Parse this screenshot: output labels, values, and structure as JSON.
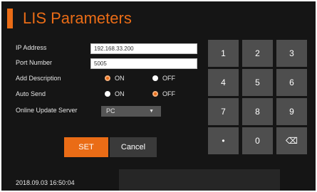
{
  "title": "LIS Parameters",
  "form": {
    "ip_label": "IP Address",
    "ip_value": "192.168.33.200",
    "port_label": "Port Number",
    "port_value": "5005",
    "add_desc_label": "Add Description",
    "add_desc_on": "ON",
    "add_desc_off": "OFF",
    "add_desc_selected": "ON",
    "auto_send_label": "Auto Send",
    "auto_send_on": "ON",
    "auto_send_off": "OFF",
    "auto_send_selected": "OFF",
    "server_label": "Online Update Server",
    "server_value": "PC"
  },
  "buttons": {
    "set": "SET",
    "cancel": "Cancel"
  },
  "keypad": {
    "k1": "1",
    "k2": "2",
    "k3": "3",
    "k4": "4",
    "k5": "5",
    "k6": "6",
    "k7": "7",
    "k8": "8",
    "k9": "9",
    "dot": "•",
    "k0": "0",
    "backspace": "⌫"
  },
  "status": {
    "datetime": "2018.09.03  16:50:04"
  },
  "colors": {
    "accent": "#ea6c16",
    "background": "#151515",
    "key": "#4e4e4e"
  }
}
